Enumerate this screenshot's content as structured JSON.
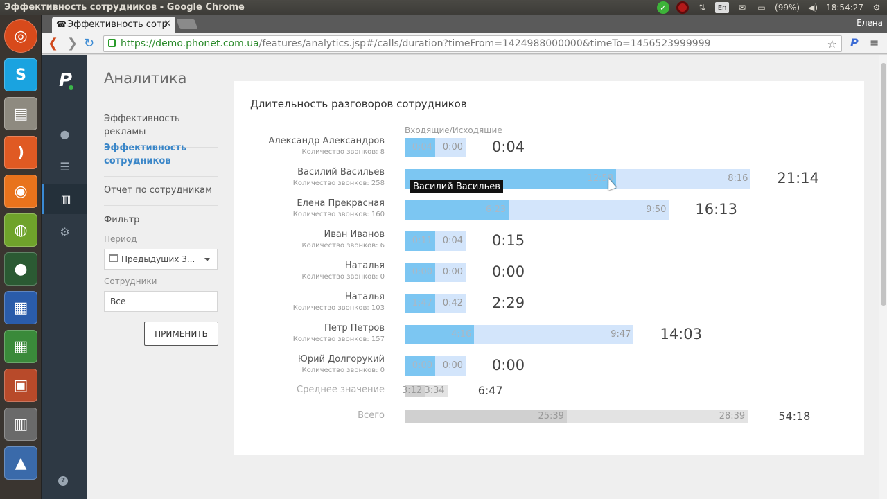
{
  "os": {
    "window_title": "Эффективность сотрудников - Google Chrome",
    "battery": "(99%)",
    "clock": "18:54:27",
    "keyboard": "En"
  },
  "browser": {
    "tab_title": "Эффективность сотр",
    "user": "Елена",
    "url_host": "https://demo.phonet.com.ua",
    "url_path": "/features/analytics.jsp#/calls/duration?timeFrom=1424988000000&timeTo=1456523999999"
  },
  "app": {
    "page_title": "Аналитика",
    "nav": [
      {
        "label": "Эффективность рекламы"
      },
      {
        "label": "Эффективность сотрудников"
      },
      {
        "label": "Отчет по сотрудникам"
      }
    ],
    "filter": {
      "title": "Фильтр",
      "period_label": "Период",
      "period_value": "Предыдущих 3...",
      "employees_label": "Сотрудники",
      "employees_value": "Все",
      "apply": "ПРИМЕНИТЬ"
    }
  },
  "report": {
    "title": "Длительность разговоров сотрудников",
    "legend": "Входящие/Исходящие",
    "tooltip": "Василий Васильев",
    "rows": [
      {
        "name": "Александр Александров",
        "count": "Количество звонков: 8",
        "in": "0:04",
        "out": "0:00",
        "total": "0:04",
        "in_sec": 4,
        "out_sec": 0
      },
      {
        "name": "Василий Васильев",
        "count": "Количество звонков: 258",
        "in": "12:58",
        "out": "8:16",
        "total": "21:14",
        "in_sec": 778,
        "out_sec": 496
      },
      {
        "name": "Елена Прекрасная",
        "count": "Количество звонков: 160",
        "in": "6:23",
        "out": "9:50",
        "total": "16:13",
        "in_sec": 383,
        "out_sec": 590
      },
      {
        "name": "Иван Иванов",
        "count": "Количество звонков: 6",
        "in": "0:11",
        "out": "0:04",
        "total": "0:15",
        "in_sec": 11,
        "out_sec": 4
      },
      {
        "name": "Наталья",
        "count": "Количество звонков: 0",
        "in": "0:00",
        "out": "0:00",
        "total": "0:00",
        "in_sec": 0,
        "out_sec": 0
      },
      {
        "name": "Наталья",
        "count": "Количество звонков: 103",
        "in": "1:47",
        "out": "0:42",
        "total": "2:29",
        "in_sec": 107,
        "out_sec": 42
      },
      {
        "name": "Петр Петров",
        "count": "Количество звонков: 157",
        "in": "4:16",
        "out": "9:47",
        "total": "14:03",
        "in_sec": 256,
        "out_sec": 587
      },
      {
        "name": "Юрий Долгорукий",
        "count": "Количество звонков: 0",
        "in": "0:00",
        "out": "0:00",
        "total": "0:00",
        "in_sec": 0,
        "out_sec": 0
      }
    ],
    "summary": [
      {
        "label": "Среднее значение",
        "in": "3:12",
        "out": "3:34",
        "total": "6:47",
        "in_sec": 192,
        "out_sec": 214
      },
      {
        "label": "Всего",
        "in": "25:39",
        "out": "28:39",
        "total": "54:18",
        "in_sec": 1539,
        "out_sec": 1719
      }
    ]
  }
}
